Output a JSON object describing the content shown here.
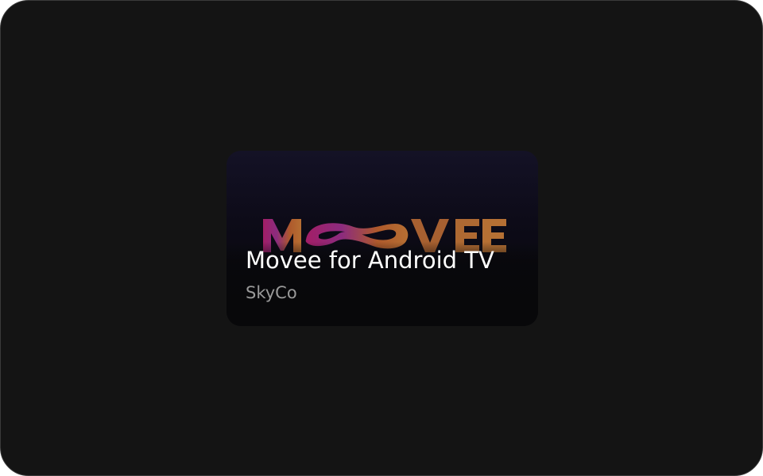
{
  "app_card": {
    "title": "Movee for Android TV",
    "developer": "SkyCo",
    "banner_logo_text": "MOVEE",
    "colors": {
      "logo_start": "#c2268c",
      "logo_end": "#d98a3a",
      "title": "#ffffff",
      "developer": "#9a9a9a",
      "screen_background": "#141414"
    }
  }
}
